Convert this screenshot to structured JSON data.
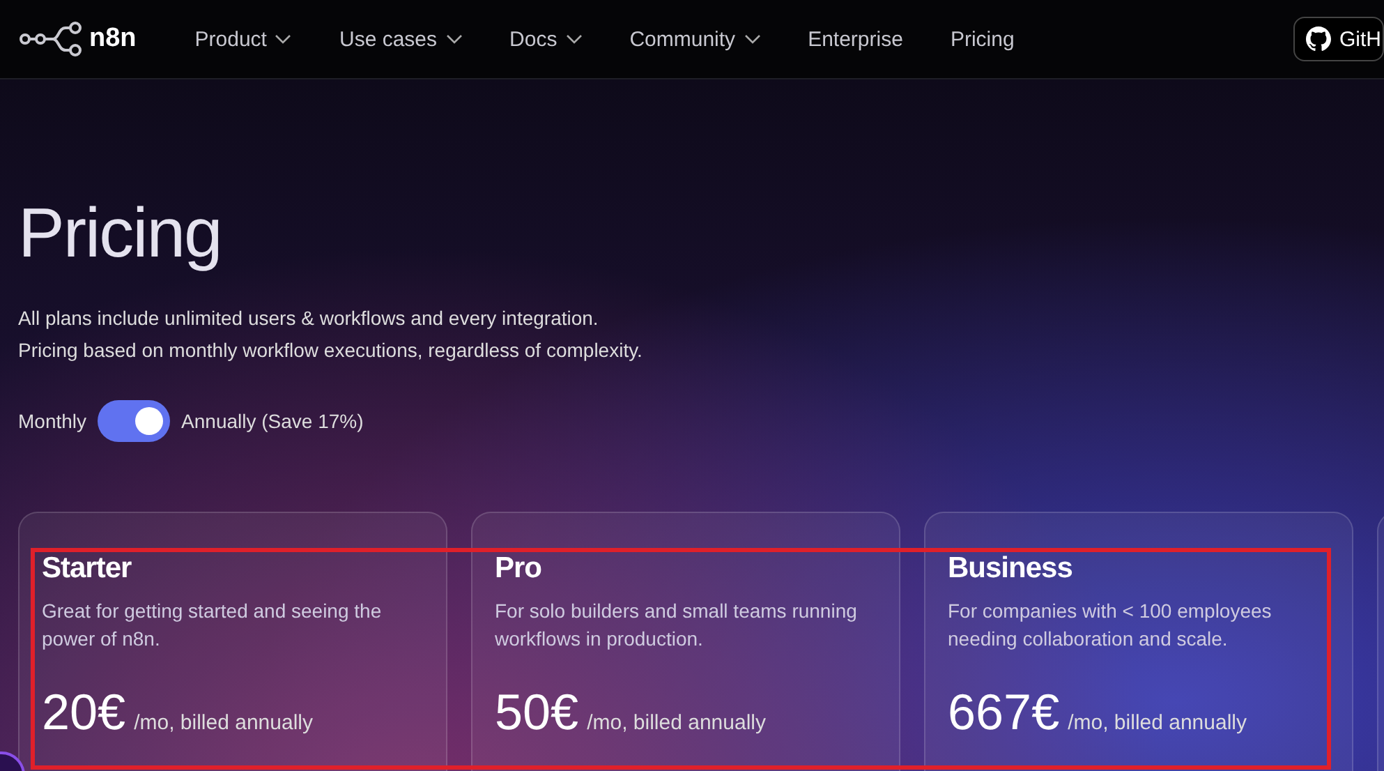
{
  "nav": {
    "logo": "n8n",
    "items": [
      {
        "label": "Product",
        "dropdown": true
      },
      {
        "label": "Use cases",
        "dropdown": true
      },
      {
        "label": "Docs",
        "dropdown": true
      },
      {
        "label": "Community",
        "dropdown": true
      },
      {
        "label": "Enterprise",
        "dropdown": false
      },
      {
        "label": "Pricing",
        "dropdown": false
      }
    ],
    "github_button": "GitH"
  },
  "heading": "Pricing",
  "intro": [
    "All plans include unlimited users & workflows and every integration.",
    "Pricing based on monthly workflow executions, regardless of complexity."
  ],
  "billing_toggle": {
    "left_label": "Monthly",
    "right_label": "Annually (Save 17%)",
    "on": true
  },
  "plans": [
    {
      "name": "Starter",
      "description": "Great for getting started and seeing the power of n8n.",
      "price": "20€",
      "period": "/mo, billed annually"
    },
    {
      "name": "Pro",
      "description": "For solo builders and small teams running workflows in production.",
      "price": "50€",
      "period": "/mo, billed annually"
    },
    {
      "name": "Business",
      "description": "For companies with < 100 employees needing collaboration and scale.",
      "price": "667€",
      "period": "/mo, billed annually"
    }
  ]
}
